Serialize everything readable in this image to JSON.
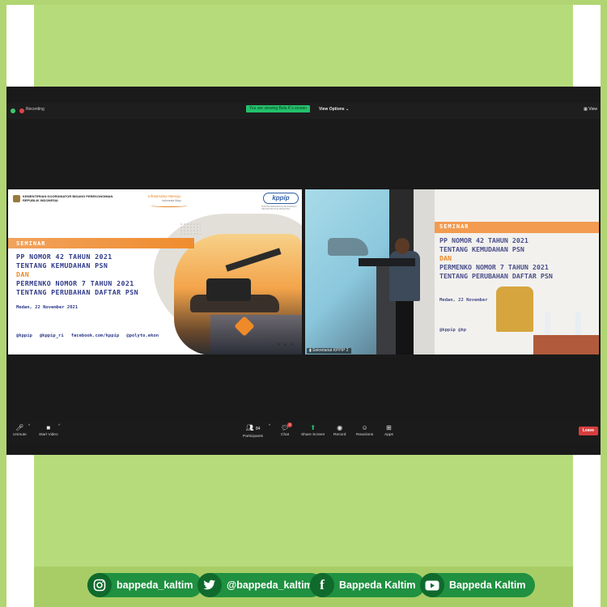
{
  "zoom": {
    "recording_label": "Recording",
    "viewing_banner": "You are viewing Bela K's screen",
    "view_options_label": "View Options",
    "view_label": "View"
  },
  "slide": {
    "ministry": "KEMENTERIAN KOORDINATOR BIDANG PEREKONOMIAN REPUBLIK INDONESIA",
    "infra_title": "Infrastruktur Menuju",
    "infra_sub": "Indonesia Maju",
    "logo": "kppip",
    "logo_sub": "KOMITE PERCEPATAN PENYEDIAAN INFRASTRUKTUR PRIORITAS",
    "seminar": "SEMINAR",
    "line1": "PP NOMOR 42 TAHUN 2021",
    "line2": "TENTANG KEMUDAHAN PSN",
    "line3": "DAN",
    "line4": "PERMENKO NOMOR 7 TAHUN 2021",
    "line5": "TENTANG PERUBAHAN DAFTAR PSN",
    "date": "Medan, 22 November 2021",
    "social": [
      "@kppip",
      "@kppip_ri",
      "facebook.com/kppip",
      "@polyto.ekon"
    ]
  },
  "video": {
    "seminar": "SEMINAR",
    "line1": "PP NOMOR 42 TAHUN 2021",
    "line2": "TENTANG KEMUDAHAN PSN",
    "line3": "DAN",
    "line4": "PERMENKO NOMOR 7 TAHUN 2021",
    "line5": "TENTANG PERUBAHAN DAFTAR PSN",
    "date": "Medan, 22 November",
    "social": "@kppip      @kp",
    "participant_label": "Sekretariat KPPIP 2"
  },
  "toolbar": {
    "unmute": "Unmute",
    "start_video": "Start Video",
    "participants": "Participants",
    "participants_count": "84",
    "chat": "Chat",
    "chat_badge": "2",
    "share_screen": "Share Screen",
    "record": "Record",
    "reactions": "Reactions",
    "apps": "Apps",
    "leave": "Leave"
  },
  "footer": {
    "instagram": "bappeda_kaltim",
    "twitter": "@bappeda_kaltim",
    "facebook": "Bappeda Kaltim",
    "youtube": "Bappeda Kaltim"
  },
  "colors": {
    "green_bg": "#b6db7b",
    "pill_green": "#1f9140",
    "accent_orange": "#ef8a29",
    "slide_blue": "#2f3a8a",
    "leave_red": "#d73e3e"
  }
}
